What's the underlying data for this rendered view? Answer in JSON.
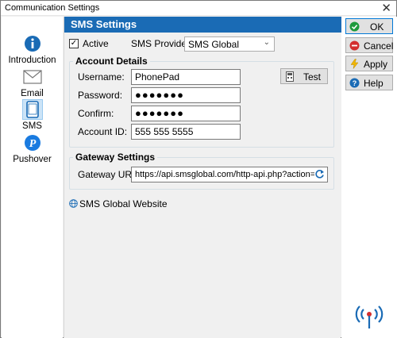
{
  "window": {
    "title": "Communication Settings",
    "close_glyph": "✕"
  },
  "sidebar": {
    "items": [
      {
        "label": "Introduction",
        "icon": "info-icon"
      },
      {
        "label": "Email",
        "icon": "envelope-icon"
      },
      {
        "label": "SMS",
        "icon": "phone-icon"
      },
      {
        "label": "Pushover",
        "icon": "pushover-icon"
      }
    ]
  },
  "main": {
    "header": "SMS Settings",
    "active_label": "Active",
    "active_checked": true,
    "provider_label": "SMS Provider:",
    "provider_value": "SMS Global",
    "account": {
      "title": "Account Details",
      "username_label": "Username:",
      "username_value": "PhonePad",
      "password_label": "Password:",
      "password_value": "●●●●●●●",
      "confirm_label": "Confirm:",
      "confirm_value": "●●●●●●●",
      "account_id_label": "Account ID:",
      "account_id_value": "555 555 5555",
      "test_label": "Test"
    },
    "gateway": {
      "title": "Gateway Settings",
      "url_label": "Gateway URL:",
      "url_value": "https://api.smsglobal.com/http-api.php?action=ser"
    },
    "website_link": "SMS Global Website"
  },
  "actions": {
    "ok": "OK",
    "cancel": "Cancel",
    "apply": "Apply",
    "help": "Help"
  },
  "colors": {
    "accent": "#1a6bb5",
    "ok": "#1e9a3c",
    "cancel": "#d32f2f",
    "apply": "#f2b600",
    "help": "#1a6bb5"
  }
}
